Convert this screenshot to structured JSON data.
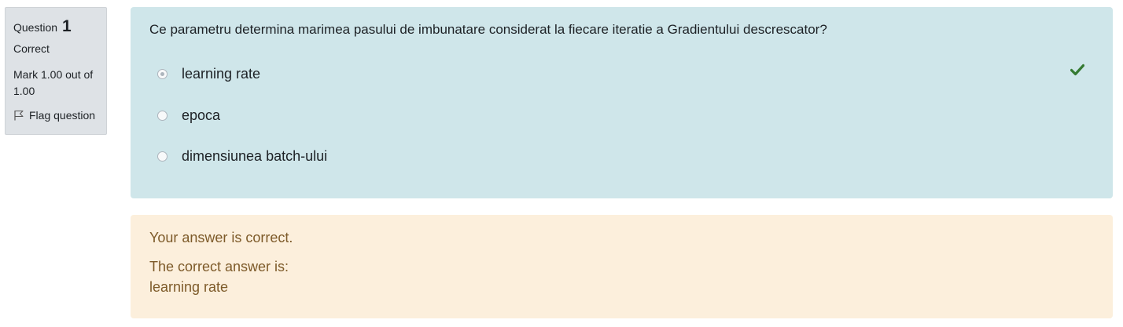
{
  "info": {
    "question_label": "Question",
    "question_number": "1",
    "state": "Correct",
    "grade": "Mark 1.00 out of 1.00",
    "flag_label": "Flag question"
  },
  "question": {
    "text": "Ce parametru determina marimea pasului de imbunatare considerat la fiecare iteratie a Gradientului descrescator?",
    "answers": [
      {
        "label": "learning rate",
        "selected": true,
        "correct": true
      },
      {
        "label": "epoca",
        "selected": false,
        "correct": false
      },
      {
        "label": "dimensiunea batch-ului",
        "selected": false,
        "correct": false
      }
    ]
  },
  "outcome": {
    "feedback": "Your answer is correct.",
    "right_answer_label": "The correct answer is:",
    "right_answer_value": "learning rate"
  },
  "colors": {
    "info_bg": "#dee2e6",
    "formulation_bg": "#cfe6ea",
    "outcome_bg": "#fcefdc",
    "outcome_text": "#7d5a29",
    "check_color": "#357a32"
  }
}
